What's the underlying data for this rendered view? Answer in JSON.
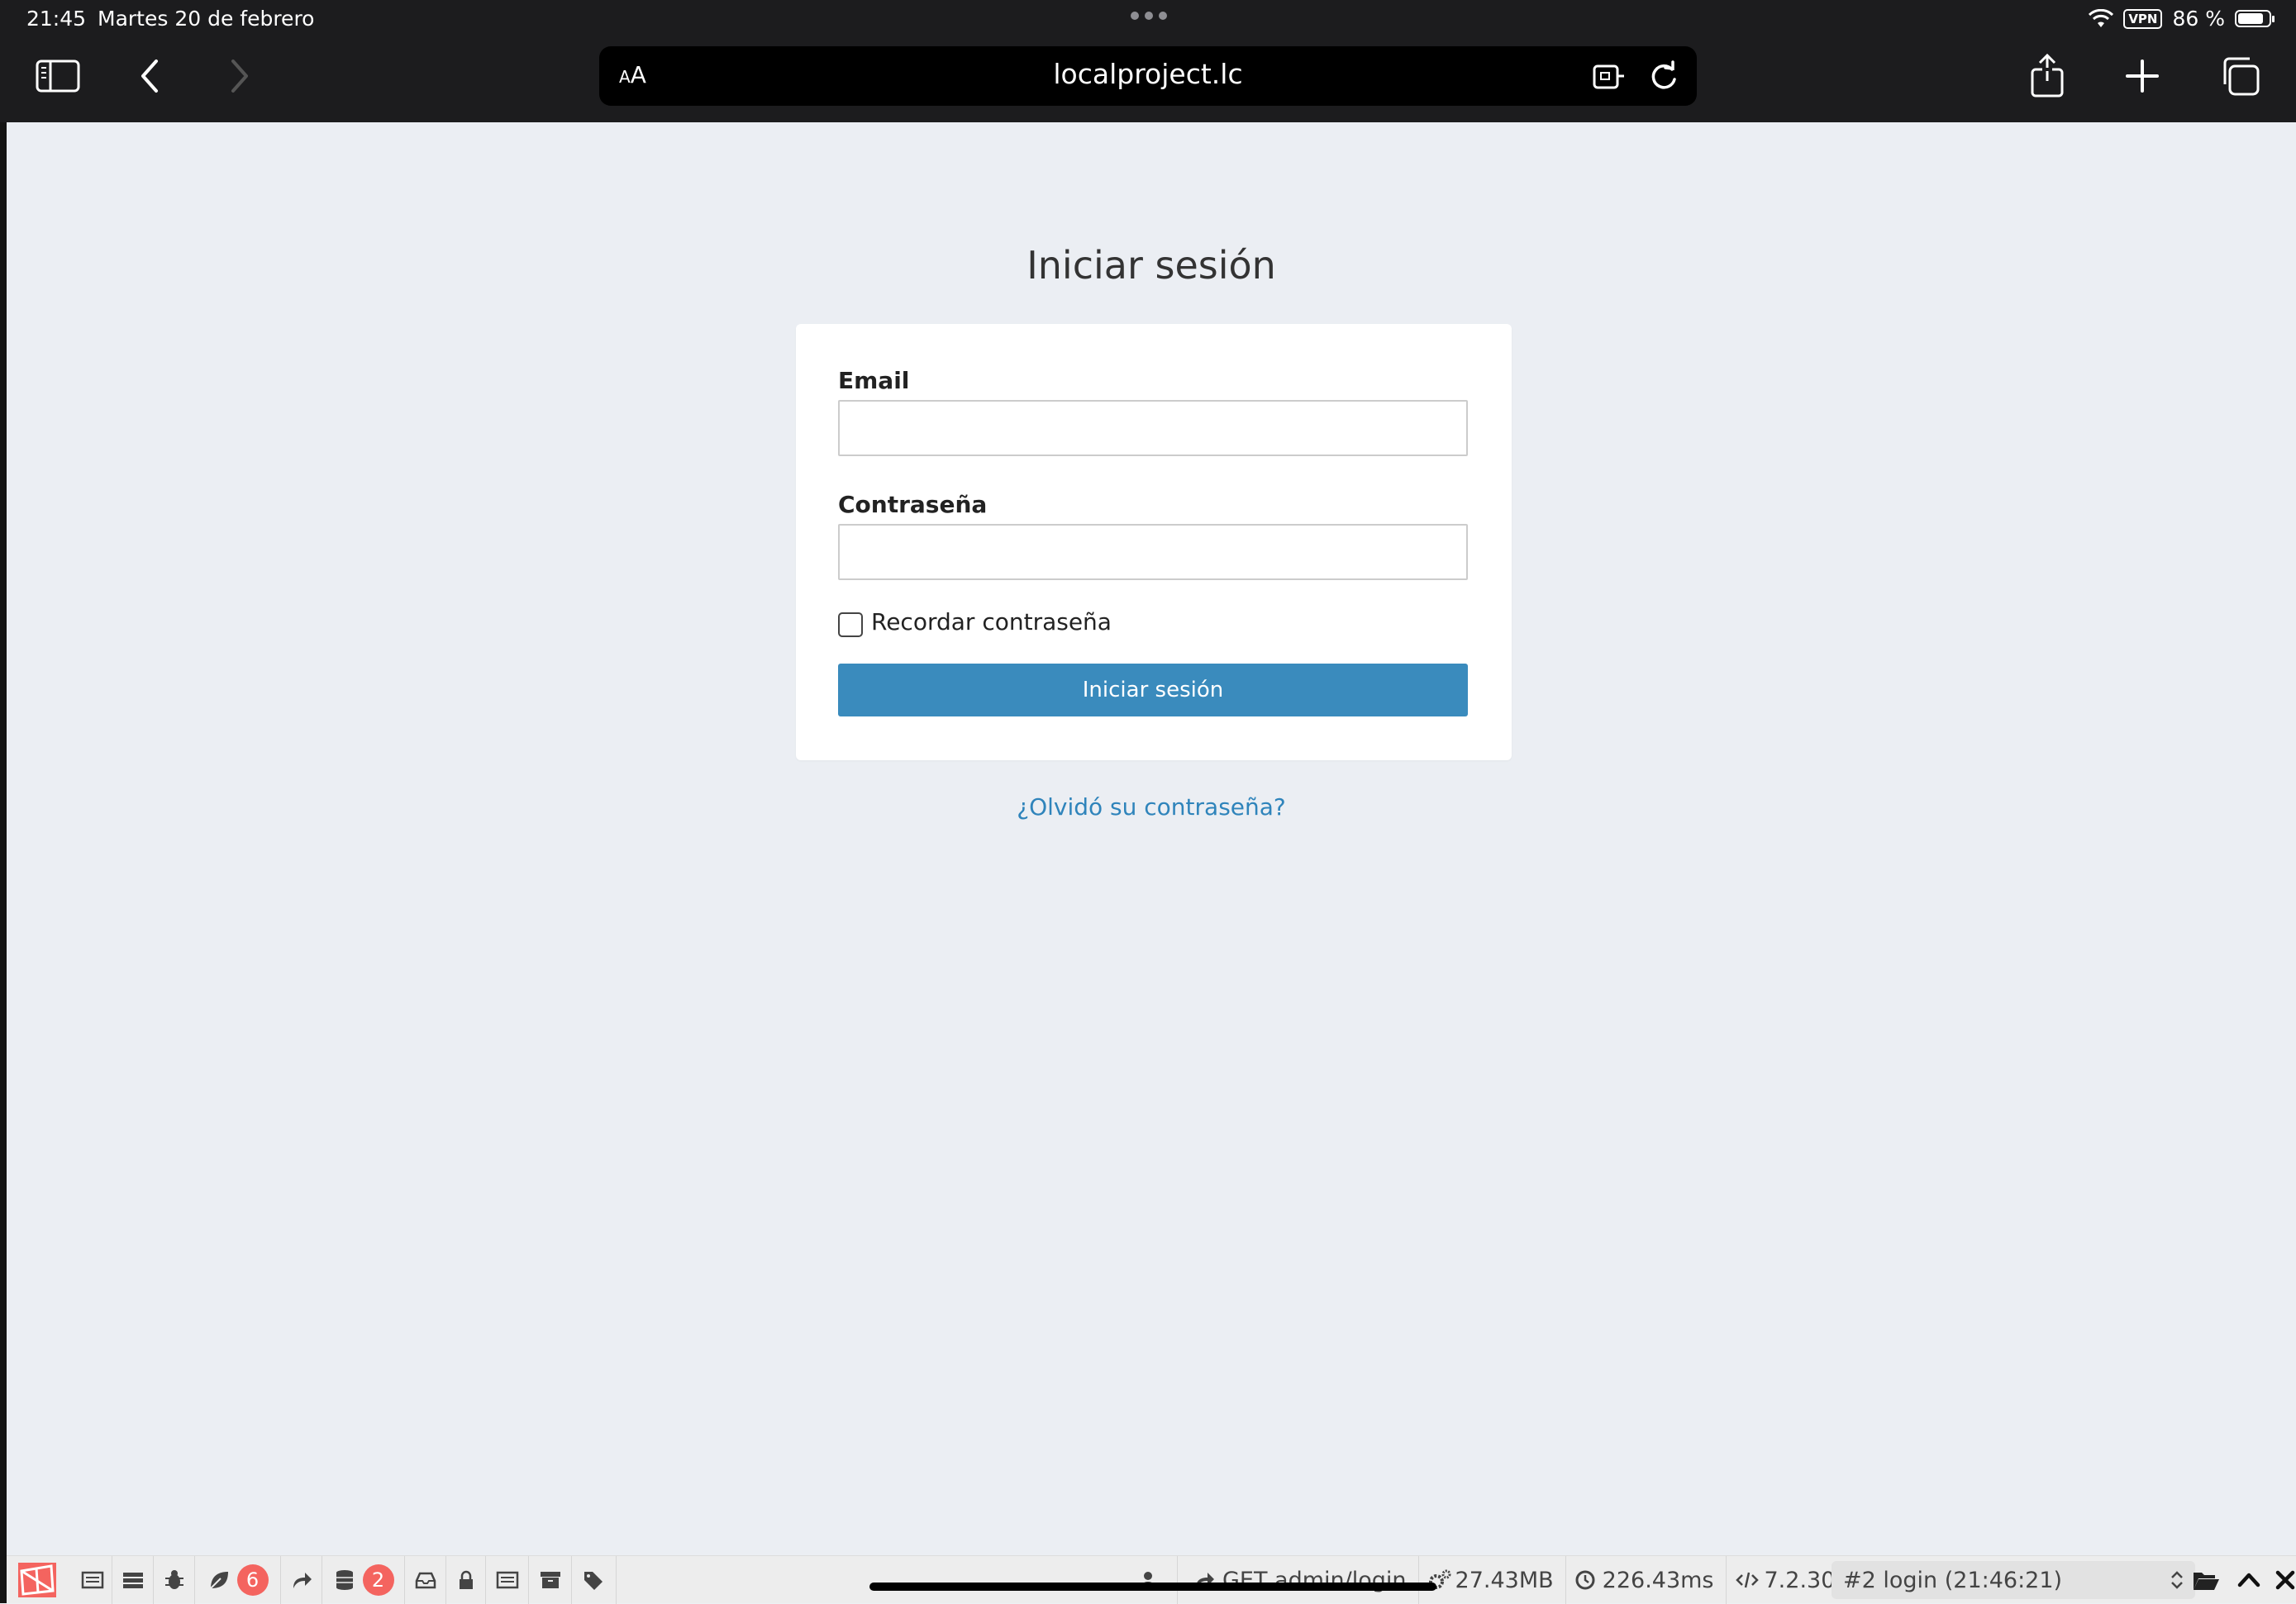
{
  "status_bar": {
    "time": "21:45",
    "date": "Martes 20 de febrero",
    "vpn": "VPN",
    "battery": "86 %",
    "battery_level": 0.86
  },
  "browser": {
    "aa_small": "A",
    "aa_large": "A",
    "url": "localproject.lc"
  },
  "login": {
    "title": "Iniciar sesión",
    "email_label": "Email",
    "email_value": "",
    "password_label": "Contraseña",
    "password_value": "",
    "remember_label": "Recordar contraseña",
    "submit_label": "Iniciar sesión",
    "forgot_link": "¿Olvidó su contraseña?"
  },
  "debugbar": {
    "tabs": [
      "messages-icon",
      "timeline-icon",
      "exceptions-icon",
      "views-icon",
      "route-icon",
      "queries-icon",
      "mails-icon",
      "gate-icon",
      "session-icon",
      "request-icon",
      "models-icon"
    ],
    "views_count": "6",
    "queries_count": "2",
    "request": "GET admin/login",
    "memory": "27.43MB",
    "time": "226.43ms",
    "php_version": "7.2.30",
    "request_select": "#2 login (21:46:21)"
  },
  "colors": {
    "chrome": "#1c1c1e",
    "page_bg": "#ebeef3",
    "primary_button": "#3a8bbd",
    "link": "#2f84bb",
    "badge": "#f4645f"
  }
}
